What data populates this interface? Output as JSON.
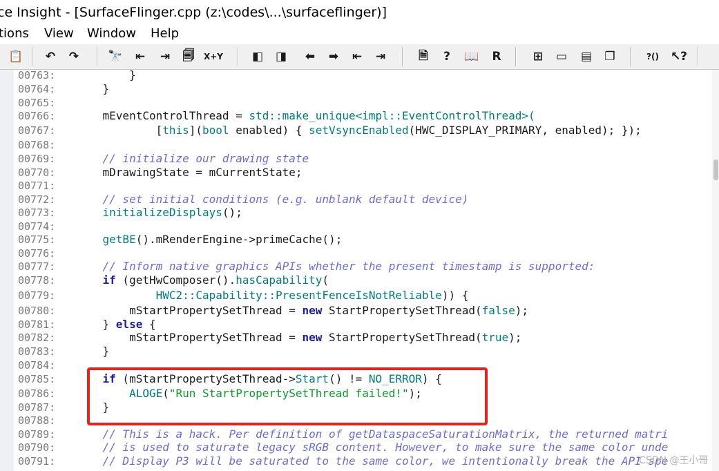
{
  "window": {
    "title": "ce Insight - [SurfaceFlinger.cpp (z:\\codes\\...\\surfaceflinger)]"
  },
  "menu": [
    "tions",
    "View",
    "Window",
    "Help"
  ],
  "toolbar": {
    "buttons": [
      {
        "icon": "paste-icon",
        "glyph": "📋"
      },
      {
        "icon": "undo-icon",
        "glyph": "↶"
      },
      {
        "icon": "redo-icon",
        "glyph": "↷"
      },
      {
        "icon": "find-icon",
        "glyph": "🔭"
      },
      {
        "icon": "find-prev-icon",
        "glyph": "⇤"
      },
      {
        "icon": "find-next-icon",
        "glyph": "⇥"
      },
      {
        "icon": "find-files-icon",
        "glyph": "🗐"
      },
      {
        "icon": "replace-icon",
        "glyph": "X+Y"
      },
      {
        "icon": "bookmark-prev-icon",
        "glyph": "◧"
      },
      {
        "icon": "bookmark-next-icon",
        "glyph": "◨"
      },
      {
        "icon": "back-icon",
        "glyph": "⬅"
      },
      {
        "icon": "forward-icon",
        "glyph": "➡"
      },
      {
        "icon": "outdent-icon",
        "glyph": "⇤"
      },
      {
        "icon": "indent-icon",
        "glyph": "⇥"
      },
      {
        "icon": "symbol-window-icon",
        "glyph": "🗎"
      },
      {
        "icon": "symbol-info-icon",
        "glyph": "?"
      },
      {
        "icon": "book-icon",
        "glyph": "📖"
      },
      {
        "icon": "relation-icon",
        "glyph": "R"
      },
      {
        "icon": "tile-icon",
        "glyph": "⊞"
      },
      {
        "icon": "panel-icon",
        "glyph": "▭"
      },
      {
        "icon": "panel2-icon",
        "glyph": "▤"
      },
      {
        "icon": "windows-icon",
        "glyph": "❐"
      },
      {
        "icon": "help-context-icon",
        "glyph": "?()"
      },
      {
        "icon": "help-pointer-icon",
        "glyph": "↖?"
      }
    ]
  },
  "code": {
    "lines": [
      {
        "n": "00763:",
        "segs": [
          {
            "t": "        }",
            "c": "cls"
          }
        ]
      },
      {
        "n": "00764:",
        "segs": [
          {
            "t": "    }",
            "c": "cls"
          }
        ]
      },
      {
        "n": "00765:",
        "segs": []
      },
      {
        "n": "00766:",
        "segs": [
          {
            "t": "    mEventControlThread = ",
            "c": "cls"
          },
          {
            "t": "std::make_unique<impl::EventControlThread>(",
            "c": "fn"
          }
        ]
      },
      {
        "n": "00767:",
        "segs": [
          {
            "t": "            [",
            "c": "cls"
          },
          {
            "t": "this",
            "c": "fn"
          },
          {
            "t": "](",
            "c": "cls"
          },
          {
            "t": "bool",
            "c": "fn"
          },
          {
            "t": " enabled) { ",
            "c": "cls"
          },
          {
            "t": "setVsyncEnabled",
            "c": "fn"
          },
          {
            "t": "(HWC_DISPLAY_PRIMARY, enabled); });",
            "c": "cls"
          }
        ]
      },
      {
        "n": "00768:",
        "segs": []
      },
      {
        "n": "00769:",
        "segs": [
          {
            "t": "    // initialize our drawing state",
            "c": "cm"
          }
        ]
      },
      {
        "n": "00770:",
        "segs": [
          {
            "t": "    mDrawingState = mCurrentState;",
            "c": "cls"
          }
        ]
      },
      {
        "n": "00771:",
        "segs": []
      },
      {
        "n": "00772:",
        "segs": [
          {
            "t": "    // set initial conditions (e.g. unblank default device)",
            "c": "cm"
          }
        ]
      },
      {
        "n": "00773:",
        "segs": [
          {
            "t": "    initializeDisplays",
            "c": "fn"
          },
          {
            "t": "();",
            "c": "cls"
          }
        ]
      },
      {
        "n": "00774:",
        "segs": []
      },
      {
        "n": "00775:",
        "segs": [
          {
            "t": "    getBE",
            "c": "fn"
          },
          {
            "t": "().mRenderEngine->primeCache();",
            "c": "cls"
          }
        ]
      },
      {
        "n": "00776:",
        "segs": []
      },
      {
        "n": "00777:",
        "segs": [
          {
            "t": "    // Inform native graphics APIs whether the present timestamp is supported:",
            "c": "cm"
          }
        ]
      },
      {
        "n": "00778:",
        "segs": [
          {
            "t": "    if",
            "c": "kw"
          },
          {
            "t": " (getHwComposer().",
            "c": "cls"
          },
          {
            "t": "hasCapability",
            "c": "fn"
          },
          {
            "t": "(",
            "c": "cls"
          }
        ]
      },
      {
        "n": "00779:",
        "segs": [
          {
            "t": "            HWC2::Capability::PresentFenceIsNotReliable",
            "c": "fn"
          },
          {
            "t": ")) {",
            "c": "cls"
          }
        ]
      },
      {
        "n": "00780:",
        "segs": [
          {
            "t": "        mStartPropertySetThread = ",
            "c": "cls"
          },
          {
            "t": "new",
            "c": "kw"
          },
          {
            "t": " StartPropertySetThread(",
            "c": "cls"
          },
          {
            "t": "false",
            "c": "fn"
          },
          {
            "t": ");",
            "c": "cls"
          }
        ]
      },
      {
        "n": "00781:",
        "segs": [
          {
            "t": "    } ",
            "c": "cls"
          },
          {
            "t": "else",
            "c": "kw"
          },
          {
            "t": " {",
            "c": "cls"
          }
        ]
      },
      {
        "n": "00782:",
        "segs": [
          {
            "t": "        mStartPropertySetThread = ",
            "c": "cls"
          },
          {
            "t": "new",
            "c": "kw"
          },
          {
            "t": " StartPropertySetThread(",
            "c": "cls"
          },
          {
            "t": "true",
            "c": "fn"
          },
          {
            "t": ");",
            "c": "cls"
          }
        ]
      },
      {
        "n": "00783:",
        "segs": [
          {
            "t": "    }",
            "c": "cls"
          }
        ]
      },
      {
        "n": "00784:",
        "segs": []
      },
      {
        "n": "00785:",
        "segs": [
          {
            "t": "    if",
            "c": "kw"
          },
          {
            "t": " (mStartPropertySetThread->",
            "c": "cls"
          },
          {
            "t": "Start",
            "c": "fn"
          },
          {
            "t": "() != ",
            "c": "cls"
          },
          {
            "t": "NO_ERROR",
            "c": "fn"
          },
          {
            "t": ") {",
            "c": "cls"
          }
        ]
      },
      {
        "n": "00786:",
        "segs": [
          {
            "t": "        ALOGE",
            "c": "fn"
          },
          {
            "t": "(",
            "c": "cls"
          },
          {
            "t": "\"Run StartPropertySetThread failed!\"",
            "c": "str"
          },
          {
            "t": ");",
            "c": "cls"
          }
        ]
      },
      {
        "n": "00787:",
        "segs": [
          {
            "t": "    }",
            "c": "cls"
          }
        ]
      },
      {
        "n": "00788:",
        "segs": []
      },
      {
        "n": "00789:",
        "segs": [
          {
            "t": "    // This is a hack. Per definition of getDataspaceSaturationMatrix, the returned matri",
            "c": "cm"
          }
        ]
      },
      {
        "n": "00790:",
        "segs": [
          {
            "t": "    // is used to saturate legacy sRGB content. However, to make sure the same color unde",
            "c": "cm"
          }
        ]
      },
      {
        "n": "00791:",
        "segs": [
          {
            "t": "    // Display P3 will be saturated to the same color, we intentionally break the API spe",
            "c": "cm"
          }
        ]
      }
    ]
  },
  "watermark": "CSDN @王小哥",
  "colors": {
    "highlight_border": "#e8231b",
    "comment": "#6b6bd6",
    "function": "#007b7b",
    "keyword": "#1a1aa6",
    "string": "#0d9a2d"
  }
}
